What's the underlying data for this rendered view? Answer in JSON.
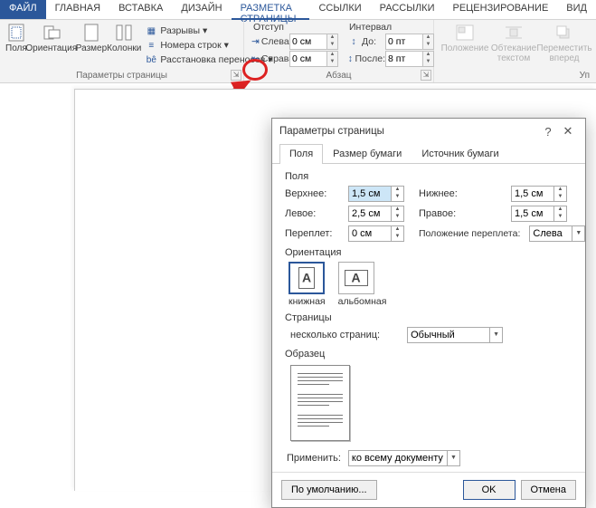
{
  "tabs": {
    "file": "ФАЙЛ",
    "home": "ГЛАВНАЯ",
    "insert": "ВСТАВКА",
    "design": "ДИЗАЙН",
    "layout": "РАЗМЕТКА СТРАНИЦЫ",
    "references": "ССЫЛКИ",
    "mailings": "РАССЫЛКИ",
    "review": "РЕЦЕНЗИРОВАНИЕ",
    "view": "ВИД"
  },
  "ribbon": {
    "margins": "Поля",
    "orientation": "Ориентация",
    "size": "Размер",
    "columns": "Колонки",
    "breaks": "Разрывы",
    "lineNumbers": "Номера строк",
    "hyphenation": "Расстановка переносов",
    "groupPageSetup": "Параметры страницы",
    "indent": "Отступ",
    "indentLeft": "Слева:",
    "indentRight": "Справа:",
    "indentLeftVal": "0 см",
    "indentRightVal": "0 см",
    "spacing": "Интервал",
    "spacingBefore": "До:",
    "spacingAfter": "После:",
    "spacingBeforeVal": "0 пт",
    "spacingAfterVal": "8 пт",
    "groupParagraph": "Абзац",
    "position": "Положение",
    "wrapText": "Обтекание текстом",
    "bringForward": "Переместить вперед",
    "arrangeSuffix": "Уп"
  },
  "dialog": {
    "title": "Параметры страницы",
    "tabMargins": "Поля",
    "tabPaper": "Размер бумаги",
    "tabSource": "Источник бумаги",
    "secMargins": "Поля",
    "top": "Верхнее:",
    "topVal": "1,5 см",
    "bottom": "Нижнее:",
    "bottomVal": "1,5 см",
    "left": "Левое:",
    "leftVal": "2,5 см",
    "right": "Правое:",
    "rightVal": "1,5 см",
    "gutter": "Переплет:",
    "gutterVal": "0 см",
    "gutterPos": "Положение переплета:",
    "gutterPosVal": "Слева",
    "secOrientation": "Ориентация",
    "portrait": "книжная",
    "landscape": "альбомная",
    "secPages": "Страницы",
    "multiPages": "несколько страниц:",
    "multiPagesVal": "Обычный",
    "secPreview": "Образец",
    "applyTo": "Применить:",
    "applyToVal": "ко всему документу",
    "default": "По умолчанию...",
    "ok": "OK",
    "cancel": "Отмена"
  }
}
